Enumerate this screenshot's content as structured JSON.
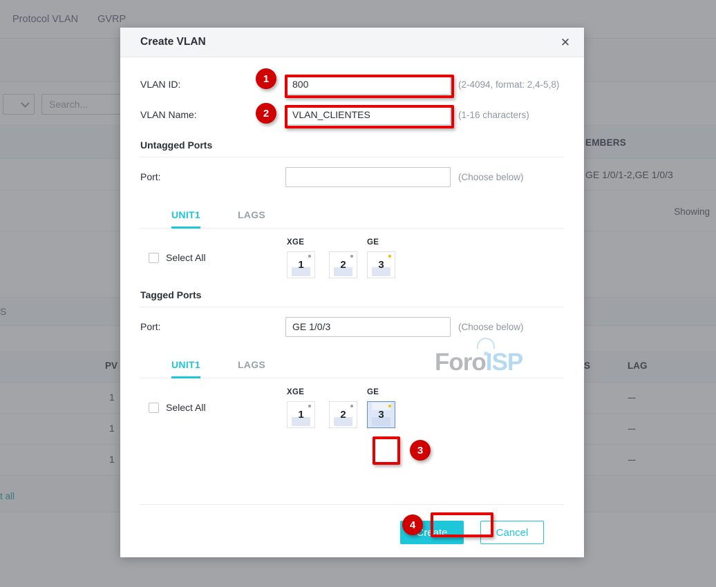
{
  "background": {
    "nav_tabs": [
      "Protocol VLAN",
      "GVRP"
    ],
    "search_placeholder": "Search...",
    "table1": {
      "headers": {
        "members": "EMBERS"
      },
      "rows": [
        {
          "members": "GE 1/0/1-2,GE 1/0/3"
        }
      ],
      "showing_text": "Showing"
    },
    "select_all_link_1": "t all",
    "section2_label": "S",
    "table2": {
      "headers": {
        "pvid": "PV",
        "status": "S",
        "lag": "LAG"
      },
      "rows": [
        {
          "pvid": "1",
          "lag": "---"
        },
        {
          "pvid": "1",
          "lag": "---"
        },
        {
          "pvid": "1",
          "lag": "---"
        }
      ]
    },
    "select_all_link_2": "t all"
  },
  "dialog": {
    "title": "Create VLAN",
    "close_icon": "close-icon",
    "fields": {
      "vlan_id": {
        "label": "VLAN ID:",
        "value": "800",
        "placeholder": "",
        "hint": "(2-4094, format: 2,4-5,8)"
      },
      "vlan_name": {
        "label": "VLAN Name:",
        "value": "VLAN_CLIENTES",
        "placeholder": "",
        "hint": "(1-16 characters)"
      }
    },
    "untagged": {
      "section_title": "Untagged Ports",
      "port_label": "Port:",
      "port_value": "",
      "port_placeholder": "",
      "port_hint": "(Choose below)",
      "tabs": [
        {
          "label": "UNIT1",
          "active": true
        },
        {
          "label": "LAGS",
          "active": false
        }
      ],
      "select_all_label": "Select All",
      "groups": [
        {
          "name": "XGE",
          "ports": [
            {
              "num": "1",
              "led": "off",
              "selected": false
            },
            {
              "num": "2",
              "led": "off",
              "selected": false
            }
          ]
        },
        {
          "name": "GE",
          "ports": [
            {
              "num": "3",
              "led": "on",
              "selected": false
            }
          ]
        }
      ]
    },
    "tagged": {
      "section_title": "Tagged Ports",
      "port_label": "Port:",
      "port_value": "GE 1/0/3",
      "port_placeholder": "",
      "port_hint": "(Choose below)",
      "tabs": [
        {
          "label": "UNIT1",
          "active": true
        },
        {
          "label": "LAGS",
          "active": false
        }
      ],
      "select_all_label": "Select All",
      "groups": [
        {
          "name": "XGE",
          "ports": [
            {
              "num": "1",
              "led": "off",
              "selected": false
            },
            {
              "num": "2",
              "led": "off",
              "selected": false
            }
          ]
        },
        {
          "name": "GE",
          "ports": [
            {
              "num": "3",
              "led": "on",
              "selected": true
            }
          ]
        }
      ]
    },
    "footer": {
      "create_label": "Create",
      "cancel_label": "Cancel"
    }
  },
  "annotations": {
    "badges": [
      "1",
      "2",
      "3",
      "4"
    ],
    "highlight_color": "#e60000",
    "badge_color": "#d10000"
  },
  "watermark": {
    "part1": "Foro",
    "part2": "ISP"
  },
  "colors": {
    "accent": "#1ec6da",
    "link": "#1f9ba5",
    "port_led_active": "#f5bc00",
    "port_selected_border": "#5a8ed6"
  }
}
